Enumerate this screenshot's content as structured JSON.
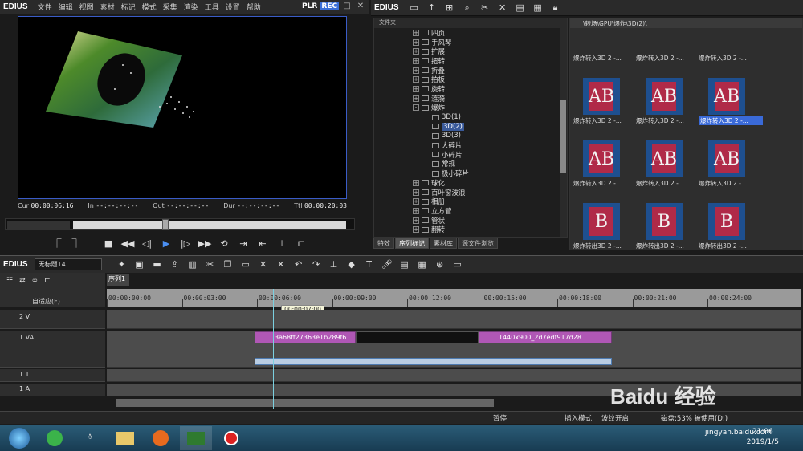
{
  "app": {
    "logo": "EDIUS",
    "menu": [
      "文件",
      "编辑",
      "视图",
      "素材",
      "标记",
      "模式",
      "采集",
      "渲染",
      "工具",
      "设置",
      "帮助"
    ],
    "plr": "PLR",
    "rec": "REC"
  },
  "player": {
    "cur_label": "Cur",
    "cur": "00:00:06:16",
    "in_label": "In",
    "in": "--:--:--:--",
    "out_label": "Out",
    "out": "--:--:--:--",
    "dur_label": "Dur",
    "dur": "--:--:--:--",
    "ttl_label": "Ttl",
    "ttl": "00:00:20:03"
  },
  "effects": {
    "panel_title": "EDIUS",
    "tree_header": "文件夹",
    "items": [
      {
        "label": "四页",
        "exp": "+"
      },
      {
        "label": "手风琴",
        "exp": "+"
      },
      {
        "label": "扩展",
        "exp": "+"
      },
      {
        "label": "扭转",
        "exp": "+"
      },
      {
        "label": "折叠",
        "exp": "+"
      },
      {
        "label": "拍板",
        "exp": "+"
      },
      {
        "label": "旋转",
        "exp": "+"
      },
      {
        "label": "涟漪",
        "exp": "+"
      },
      {
        "label": "爆炸",
        "exp": "-"
      },
      {
        "label": "3D(1)",
        "child": true
      },
      {
        "label": "3D(2)",
        "child": true,
        "selected": true
      },
      {
        "label": "3D(3)",
        "child": true
      },
      {
        "label": "大碎片",
        "child": true
      },
      {
        "label": "小碎片",
        "child": true
      },
      {
        "label": "常规",
        "child": true
      },
      {
        "label": "极小碎片",
        "child": true
      },
      {
        "label": "球化",
        "exp": "+"
      },
      {
        "label": "百叶窗波浪",
        "exp": "+"
      },
      {
        "label": "相册",
        "exp": "+"
      },
      {
        "label": "立方管",
        "exp": "+"
      },
      {
        "label": "管状",
        "exp": "+"
      },
      {
        "label": "翻转",
        "exp": "+"
      }
    ],
    "tabs": [
      "特效",
      "序列标记",
      "素材库",
      "源文件浏览"
    ],
    "active_tab": 1
  },
  "bin": {
    "path": "\\转场\\GPU\\爆炸\\3D(2)\\",
    "captions": [
      "爆炸转入3D 2 -...",
      "爆炸转入3D 2 -...",
      "爆炸转入3D 2 -...",
      "爆炸转入3D 2 -...",
      "爆炸转入3D 2 -...",
      "爆炸转入3D 2 -...",
      "爆炸转入3D 2 -...",
      "爆炸转入3D 2 -...",
      "爆炸转入3D 2 -...",
      "爆炸转出3D 2 -...",
      "爆炸转出3D 2 -...",
      "爆炸转出3D 2 -..."
    ],
    "selected_index": 5
  },
  "timeline": {
    "logo": "EDIUS",
    "project": "无标题14",
    "sequence_tab": "序列1",
    "zoom": "自适应(F)",
    "ruler": [
      "00:00:00:00",
      "00:00:03:00",
      "00:00:06:00",
      "00:00:09:00",
      "00:00:12:00",
      "00:00:15:00",
      "00:00:18:00",
      "00:00:21:00",
      "00:00:24:00"
    ],
    "tooltip": "00:00:07:00",
    "tracks": [
      {
        "name": "2 V"
      },
      {
        "name": "1 VA"
      },
      {
        "name": "1 T"
      },
      {
        "name": "1 A"
      }
    ],
    "clips": [
      {
        "label": "3a68ff27363e1b289f6..."
      },
      {
        "label": "1440x900_2d7edf917d28..."
      }
    ]
  },
  "status": {
    "pause": "暂停",
    "insert": "插入模式",
    "ripple": "波纹开启",
    "disk": "磁盘:53% 被使用(D:)"
  },
  "taskbar": {
    "time": "21:06",
    "date": "2019/1/5"
  },
  "watermark": {
    "text": "Baidu 经验",
    "sub": "jingyan.baidu.com"
  }
}
